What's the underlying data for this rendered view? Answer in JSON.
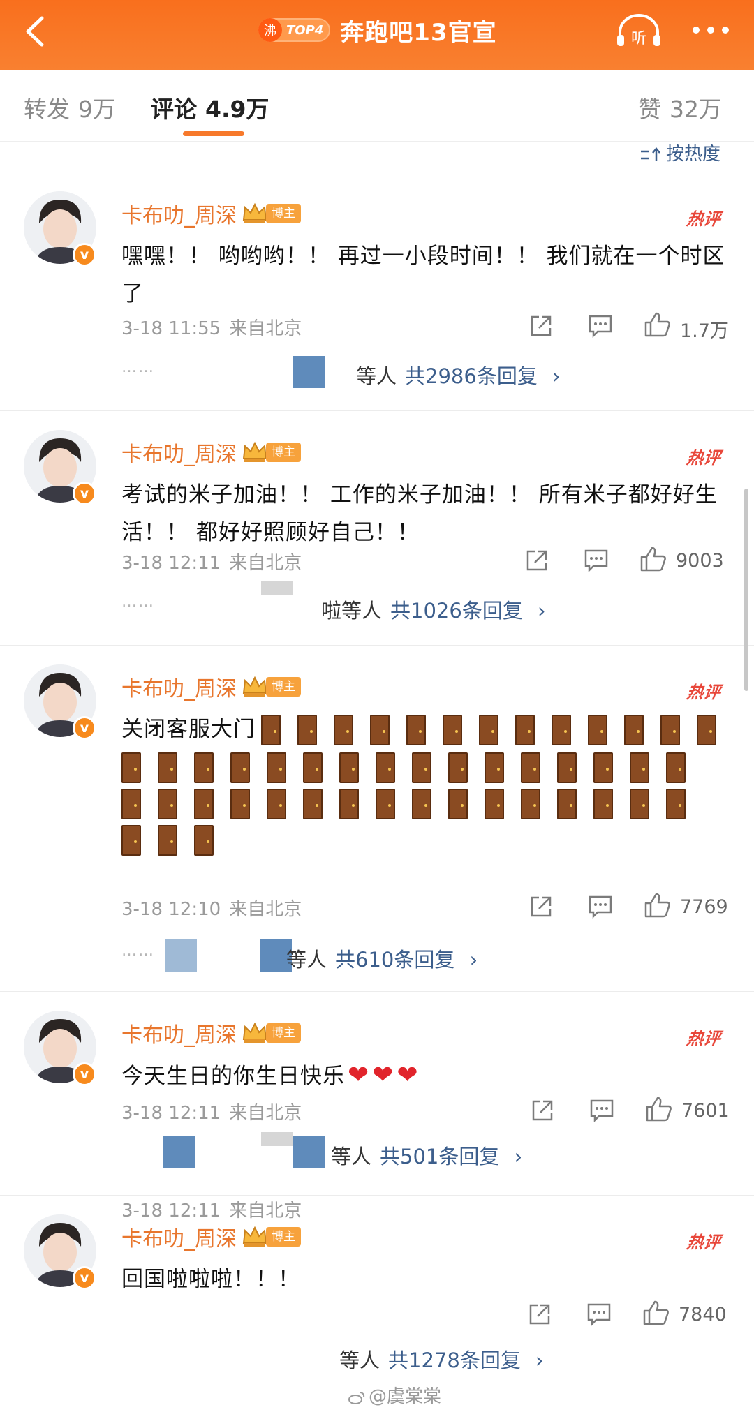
{
  "header": {
    "hot_icon_text": "沸",
    "hot_rank": "TOP4",
    "topic_title": "奔跑吧13官宣",
    "listen_label": "听"
  },
  "tabs": {
    "repost": {
      "label": "转发",
      "count": "9万"
    },
    "comment": {
      "label": "评论",
      "count": "4.9万"
    },
    "like": {
      "label": "赞",
      "count": "32万"
    },
    "sort_label": "按热度"
  },
  "comments": [
    {
      "username": "卡布叻_周深",
      "role_badge": "博主",
      "hot_tag": "热评",
      "text": "嘿嘿！！ 哟哟哟！！ 再过一小段时间！！ 我们就在一个时区了",
      "time": "3-18 11:55",
      "source": "来自北京",
      "likes": "1.7万",
      "reply_prefix": "等人",
      "reply_link": "共2986条回复"
    },
    {
      "username": "卡布叻_周深",
      "role_badge": "博主",
      "hot_tag": "热评",
      "text": "考试的米子加油！！ 工作的米子加油！！ 所有米子都好好生活！！ 都好好照顾好自己！！",
      "time": "3-18 12:11",
      "source": "来自北京",
      "likes": "9003",
      "reply_prefix": "啦等人",
      "reply_link": "共1026条回复"
    },
    {
      "username": "卡布叻_周深",
      "role_badge": "博主",
      "hot_tag": "热评",
      "text": "关闭客服大门",
      "time": "3-18 12:10",
      "source": "来自北京",
      "likes": "7769",
      "reply_prefix": "等人",
      "reply_link": "共610条回复"
    },
    {
      "username": "卡布叻_周深",
      "role_badge": "博主",
      "hot_tag": "热评",
      "text": "今天生日的你生日快乐",
      "time": "3-18 12:11",
      "source": "来自北京",
      "likes": "7601",
      "reply_prefix": "等人",
      "reply_link": "共501条回复"
    },
    {
      "username": "卡布叻_周深",
      "role_badge": "博主",
      "hot_tag": "热评",
      "text": "回国啦啦啦！！！",
      "time": "3-18 12:11",
      "source": "来自北京",
      "likes": "7840",
      "reply_prefix": "等人",
      "reply_link": "共1278条回复"
    }
  ],
  "watermark": "@虞棠棠"
}
